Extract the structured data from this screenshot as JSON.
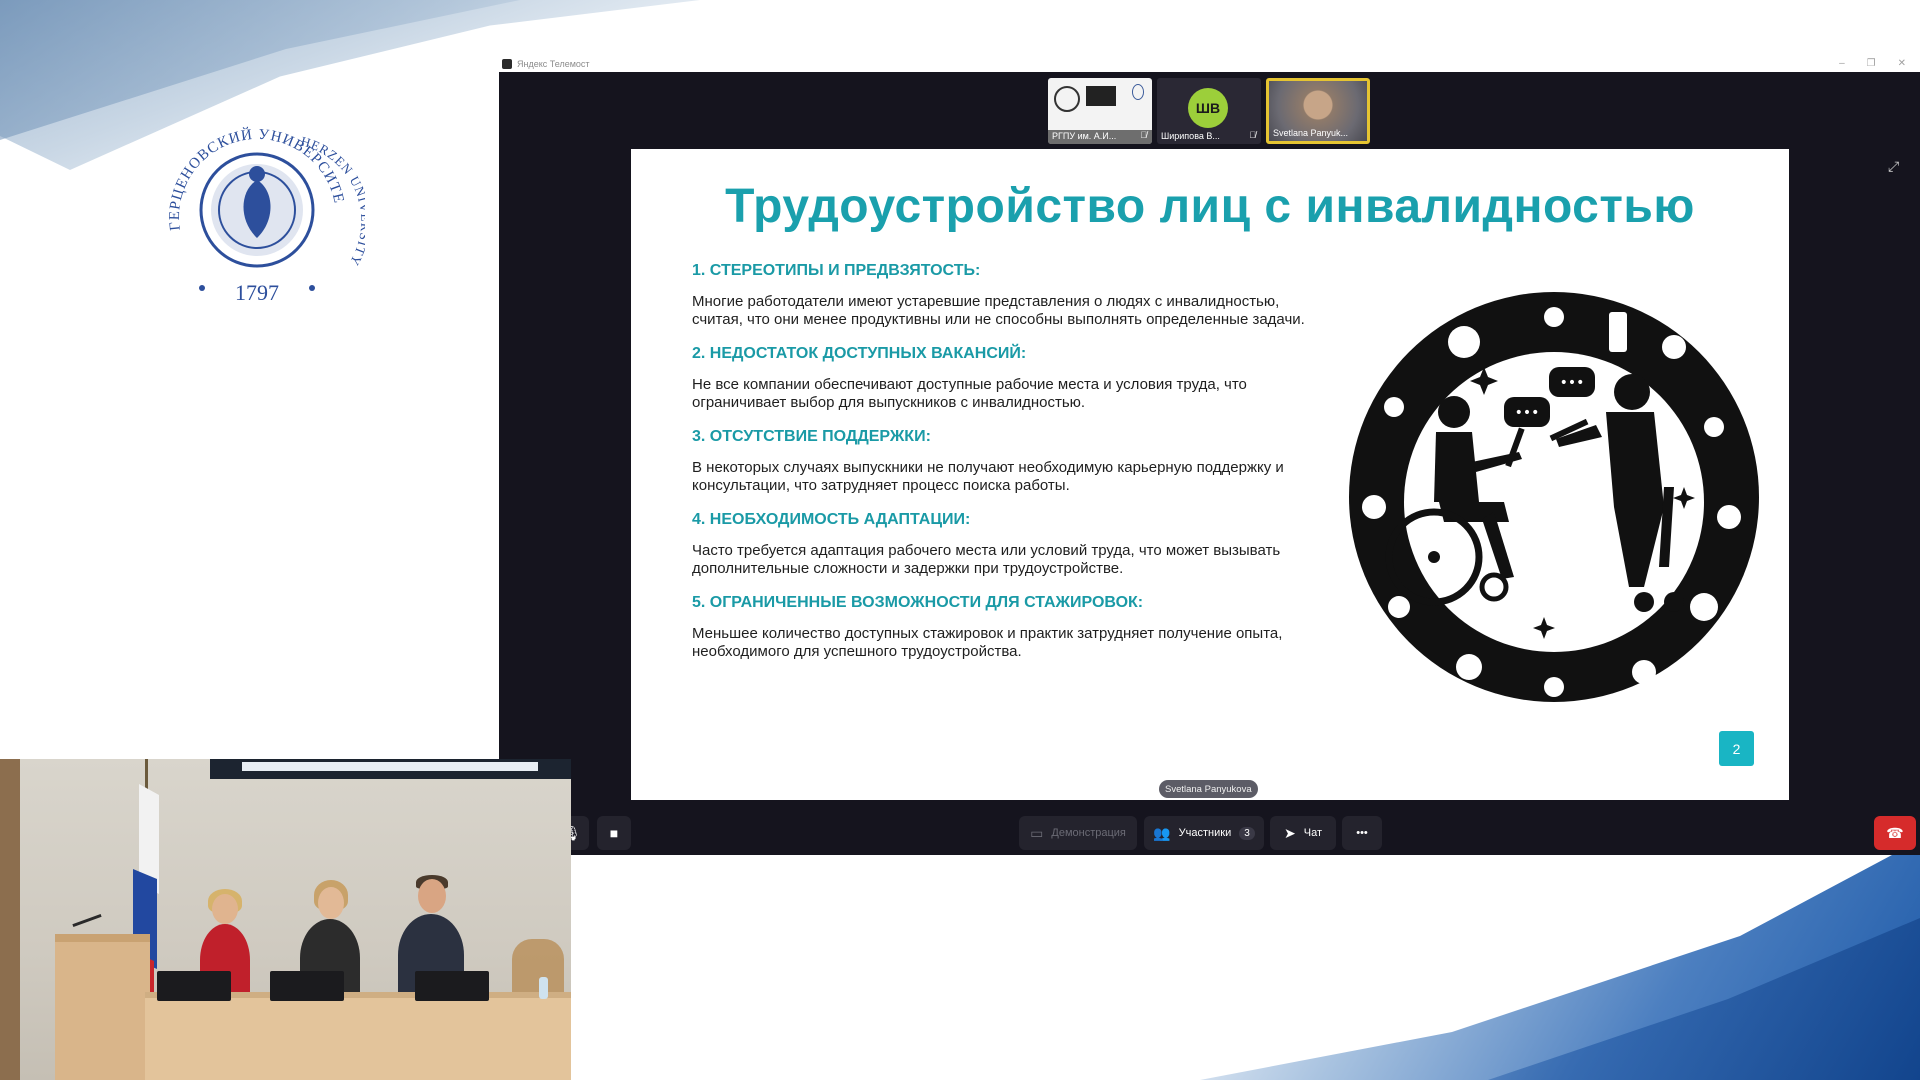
{
  "logo": {
    "top_text": "ГЕРЦЕНОВСКИЙ УНИВЕРСИТЕТ",
    "right_text": "HERZEN UNIVERSITY",
    "year": "1797"
  },
  "window": {
    "title": "Яндекс Телемост",
    "controls": [
      "–",
      "❐",
      "✕"
    ]
  },
  "participants": [
    {
      "name": "РГПУ им. А.И...",
      "type": "screen",
      "muted": true
    },
    {
      "name": "Ширипова В...",
      "initials": "ШВ",
      "type": "avatar",
      "muted": true,
      "avatar_color": "#9ccf3a"
    },
    {
      "name": "Svetlana Panyuk...",
      "type": "camera",
      "muted": false,
      "active": true
    }
  ],
  "slide": {
    "title": "Трудоустройство лиц с инвалидностью",
    "items": [
      {
        "heading": "1. СТЕРЕОТИПЫ И ПРЕДВЗЯТОСТЬ:",
        "text": "Многие работодатели имеют устаревшие представления о людях с инвалидностью, считая, что они менее продуктивны или не способны выполнять определенные задачи."
      },
      {
        "heading": "2. НЕДОСТАТОК ДОСТУПНЫХ ВАКАНСИЙ:",
        "text": "Не все компании обеспечивают доступные рабочие места и условия труда, что ограничивает выбор для выпускников с инвалидностью."
      },
      {
        "heading": "3. ОТСУТСТВИЕ ПОДДЕРЖКИ:",
        "text": "В некоторых случаях выпускники не получают необходимую карьерную поддержку и консультации, что затрудняет процесс поиска работы."
      },
      {
        "heading": "4. НЕОБХОДИМОСТЬ АДАПТАЦИИ:",
        "text": "Часто требуется адаптация рабочего места или условий труда, что может вызывать дополнительные сложности и задержки при трудоустройстве."
      },
      {
        "heading": "5. ОГРАНИЧЕННЫЕ ВОЗМОЖНОСТИ ДЛЯ СТАЖИРОВОК:",
        "text": "Меньшее количество доступных стажировок и практик затрудняет получение опыта, необходимого для успешного трудоустройства."
      }
    ],
    "page_number": "2",
    "title_color": "#1aa0ad",
    "badge_color": "#19b5c4"
  },
  "speaker_tag": "Svetlana Panyukova",
  "controls": {
    "demo_label": "Демонстрация",
    "participants_label": "Участники",
    "participants_count": "3",
    "chat_label": "Чат",
    "more_label": "•••"
  }
}
